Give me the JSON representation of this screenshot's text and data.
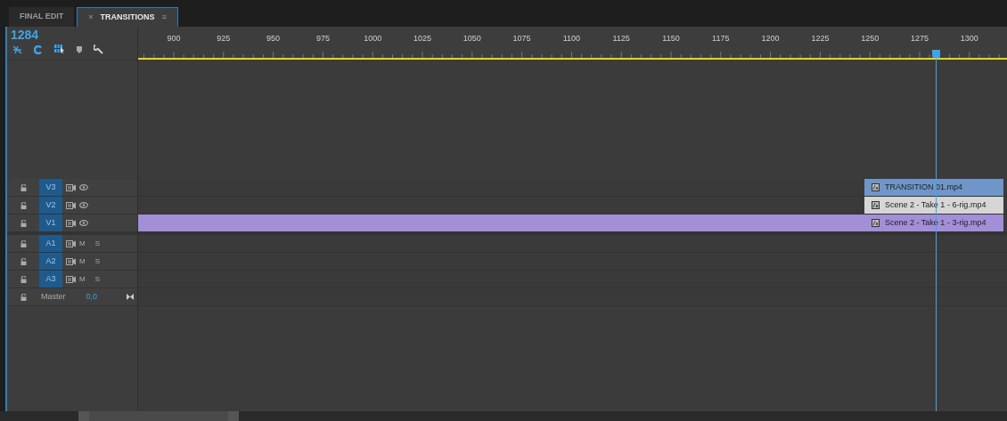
{
  "tabs": [
    {
      "label": "FINAL EDIT",
      "selected": false
    },
    {
      "label": "TRANSITIONS",
      "selected": true,
      "close": "×",
      "menu": "≡"
    }
  ],
  "timecode": "1284",
  "ruler": {
    "labels": [
      "900",
      "925",
      "950",
      "975",
      "1000",
      "1025",
      "1050",
      "1075",
      "1100",
      "1125",
      "1150",
      "1175",
      "1200",
      "1225",
      "1250",
      "1275",
      "1300"
    ],
    "playhead": {
      "level": 0.918
    }
  },
  "tracks": [
    {
      "kind": "video",
      "name": "V3",
      "targeted": true,
      "clips": [
        {
          "kind": "tail",
          "name": "TRANSITION 01.mp4",
          "color": "#6f96c9"
        }
      ]
    },
    {
      "kind": "video",
      "name": "V2",
      "targeted": true,
      "clips": [
        {
          "kind": "tail",
          "name": "Scene 2 - Take 1 - 6-rig.mp4",
          "color": "#d6d6d6"
        }
      ]
    },
    {
      "kind": "video",
      "name": "V1",
      "targeted": true,
      "clips": [
        {
          "kind": "full",
          "name": "Scene 2 - Take 1 - 3-rig.mp4",
          "color": "#a38ed8"
        }
      ]
    },
    {
      "kind": "audio",
      "name": "A1",
      "targeted": true,
      "mute": "M",
      "solo": "S"
    },
    {
      "kind": "audio",
      "name": "A2",
      "targeted": true,
      "mute": "M",
      "solo": "S"
    },
    {
      "kind": "audio",
      "name": "A3",
      "targeted": true,
      "mute": "M",
      "solo": "S"
    },
    {
      "kind": "master",
      "name": "Master",
      "value": "0,0"
    }
  ]
}
